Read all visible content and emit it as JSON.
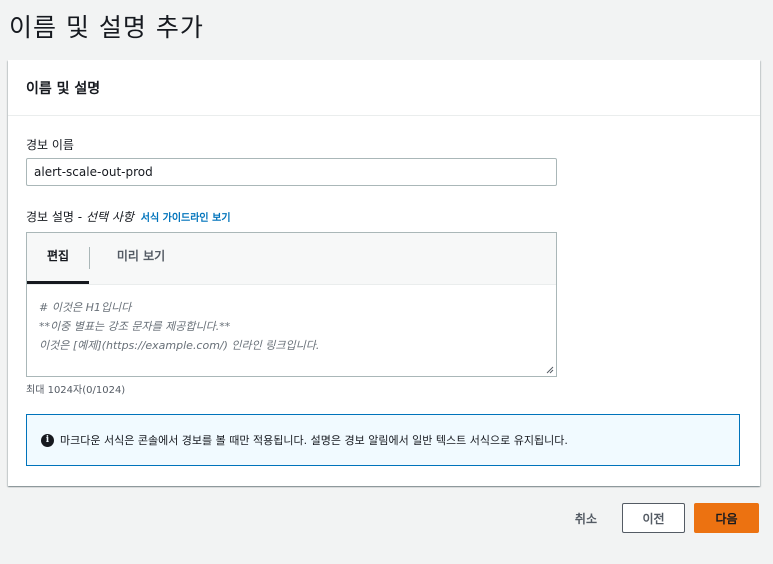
{
  "page": {
    "title": "이름 및 설명 추가"
  },
  "panel": {
    "title": "이름 및 설명",
    "alarm_name": {
      "label": "경보 이름",
      "value": "alert-scale-out-prod"
    },
    "alarm_description": {
      "label": "경보 설명 - ",
      "optional": "선택 사항",
      "guide_link": "서식 가이드라인 보기",
      "tabs": [
        {
          "label": "편집"
        },
        {
          "label": "미리 보기"
        }
      ],
      "placeholder_lines": [
        "# 이것은 H1입니다",
        "**이중 별표는 강조 문자를 제공합니다.**",
        "이것은 [예제](https://example.com/) 인라인 링크입니다."
      ],
      "char_count": "최대 1024자(0/1024)"
    },
    "info": {
      "icon": "info-icon",
      "text": "마크다운 서식은 콘솔에서 경보를 볼 때만 적용됩니다. 설명은 경보 알림에서 일반 텍스트 서식으로 유지됩니다."
    }
  },
  "actions": {
    "cancel": "취소",
    "previous": "이전",
    "next": "다음"
  },
  "colors": {
    "primary": "#ec7211",
    "link": "#0073bb",
    "info_border": "#0073bb",
    "info_bg": "#f1faff"
  }
}
